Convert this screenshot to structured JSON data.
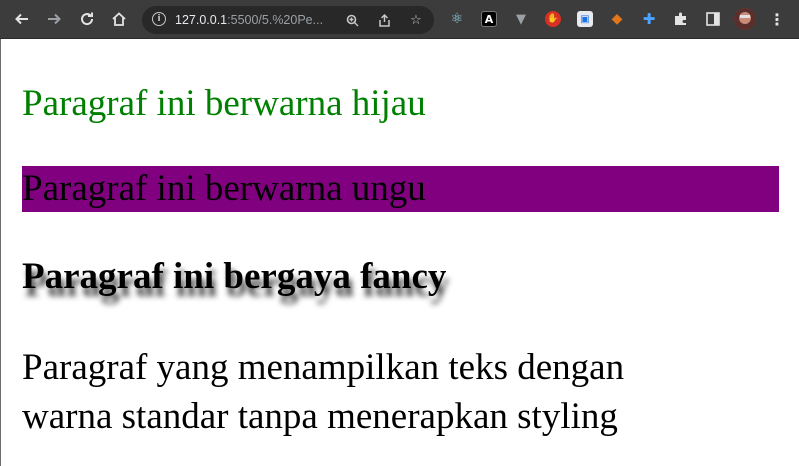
{
  "browser": {
    "nav": {
      "back_icon": "arrow-left-icon",
      "forward_icon": "arrow-right-icon",
      "reload_icon": "reload-icon",
      "home_icon": "home-icon"
    },
    "omnibox": {
      "url_host": "127.0.0.1",
      "url_rest": ":5500/5.%20Pe..."
    },
    "omnibox_icons": [
      "zoom-icon",
      "share-icon",
      "star-icon"
    ],
    "extensions": [
      "react-devtools-icon",
      "angular-icon",
      "vue-icon",
      "block-icon",
      "extension-blue-icon",
      "metamask-icon",
      "extension-cross-icon",
      "puzzle-icon",
      "sidepanel-icon",
      "profile-avatar-icon",
      "menu-icon"
    ]
  },
  "page": {
    "green_text": "Paragraf ini berwarna hijau",
    "purple_text": "Paragraf ini berwarna ungu",
    "fancy_text": "Paragraf ini bergaya fancy",
    "plain_text": "Paragraf yang menampilkan teks dengan warna standar tanpa menerapkan styling"
  },
  "colors": {
    "green": "#008000",
    "purple_bg": "#800080",
    "toolbar_bg": "#3c3c3c"
  }
}
